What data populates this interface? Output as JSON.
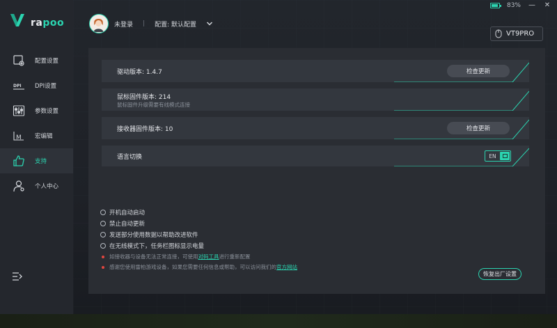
{
  "window": {
    "battery_percent": "83%",
    "battery_level": 0.83,
    "minimize_glyph": "—",
    "close_glyph": "✕"
  },
  "logo": {
    "brand_prefix": "ra",
    "brand_suffix": "poo",
    "mark_color": "#2bd4b0"
  },
  "sidebar": {
    "items": [
      {
        "label": "配置设置",
        "icon": "settings-config-icon",
        "active": false
      },
      {
        "label": "DPI设置",
        "icon": "dpi-icon",
        "active": false
      },
      {
        "label": "参数设置",
        "icon": "sliders-icon",
        "active": false
      },
      {
        "label": "宏编辑",
        "icon": "macro-icon",
        "active": false
      },
      {
        "label": "支持",
        "icon": "thumbs-up-icon",
        "active": true
      },
      {
        "label": "个人中心",
        "icon": "user-icon",
        "active": false
      }
    ],
    "collapse_icon": "menu-expand-icon"
  },
  "header": {
    "login_status": "未登录",
    "separator": "|",
    "profile_label": "配置: 默认配置",
    "device_name": "VT9PRO"
  },
  "support": {
    "driver_version_label": "驱动版本: 1.4.7",
    "check_update_label": "检查更新",
    "mouse_firmware_label": "鼠标固件版本: 214",
    "mouse_firmware_note": "鼠标固件升级需要有线模式连接",
    "receiver_firmware_label": "接收器固件版本: 10",
    "receiver_check_update_label": "检查更新",
    "language_label": "语言切换",
    "language_value": "EN",
    "options": [
      "开机自动启动",
      "禁止自动更新",
      "发送部分使用数据以帮助改进软件",
      "在无线模式下，任务栏图标显示电量"
    ],
    "note1_before": "如接收器与设备无法正常连接，可使用",
    "note1_link": "对码工具",
    "note1_after": "进行重新配置",
    "note2_before": "感谢您使用雷柏游戏设备，如果您需要任何信息或帮助，可以访问我们的",
    "note2_link": "官方网站",
    "reset_label": "恢复出厂设置"
  },
  "colors": {
    "accent": "#2bd4b0",
    "warning_dot": "#e2463f"
  }
}
